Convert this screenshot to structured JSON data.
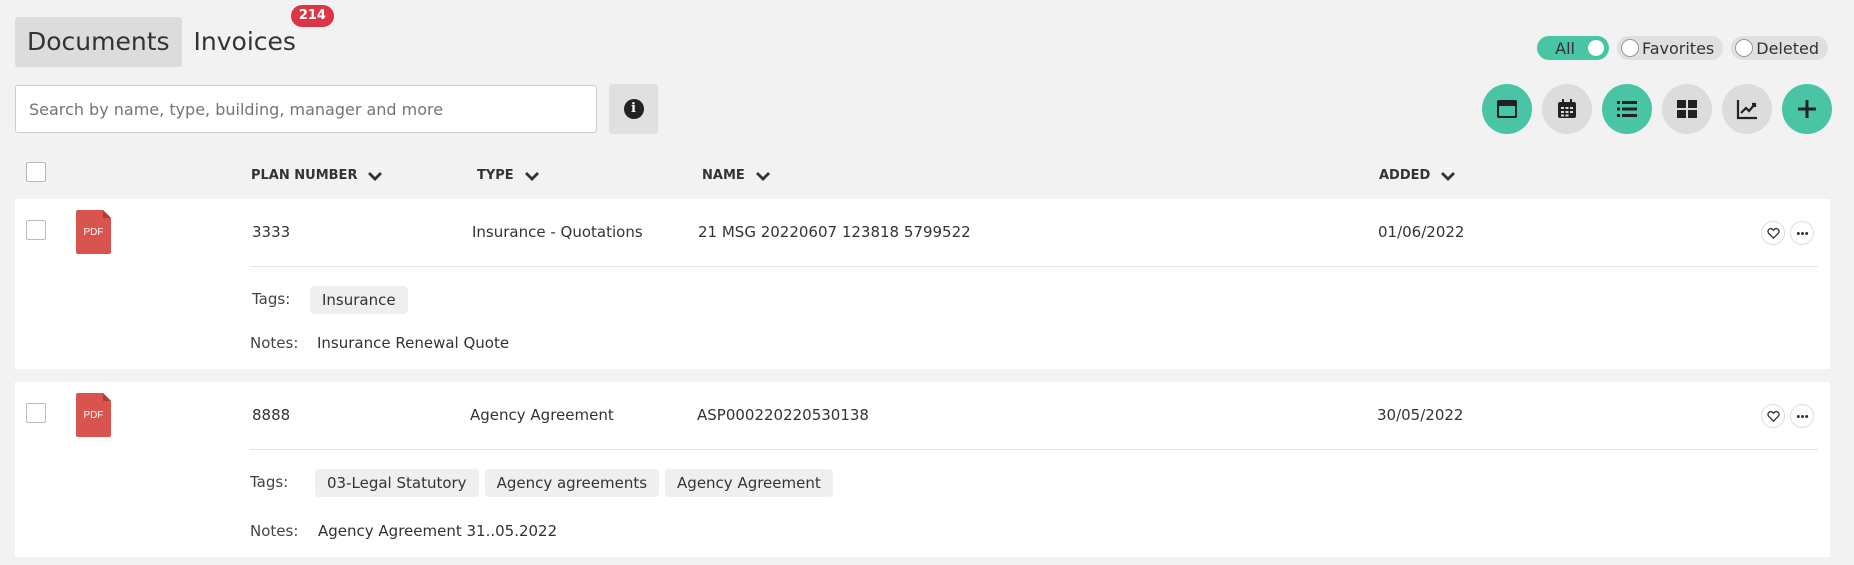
{
  "tabs": [
    {
      "label": "Documents"
    },
    {
      "label": "Invoices",
      "badge": "214"
    }
  ],
  "filters": {
    "all": "All",
    "favorites": "Favorites",
    "deleted": "Deleted"
  },
  "search": {
    "placeholder": "Search by name, type, building, manager and more"
  },
  "toolbar": [
    "card-view-icon",
    "calendar-icon",
    "list-view-icon",
    "grid-view-icon",
    "chart-icon",
    "plus-icon"
  ],
  "columns": {
    "plan_number": "PLAN NUMBER",
    "type": "TYPE",
    "name": "NAME",
    "added": "ADDED"
  },
  "labels": {
    "tags": "Tags:",
    "notes": "Notes:"
  },
  "rows": [
    {
      "file_type": "PDF",
      "plan_number": "3333",
      "type": "Insurance - Quotations",
      "name": "21 MSG 20220607 123818 5799522",
      "added": "01/06/2022",
      "tags": [
        "Insurance"
      ],
      "notes": "Insurance Renewal Quote"
    },
    {
      "file_type": "PDF",
      "plan_number": "8888",
      "type": "Agency Agreement",
      "name": "ASP000220220530138",
      "added": "30/05/2022",
      "tags": [
        "03-Legal Statutory",
        "Agency agreements",
        "Agency Agreement"
      ],
      "notes": "Agency Agreement 31..05.2022"
    }
  ],
  "colors": {
    "accent": "#49c5a6",
    "badge": "#dc3545",
    "pdf": "#d9534f"
  }
}
